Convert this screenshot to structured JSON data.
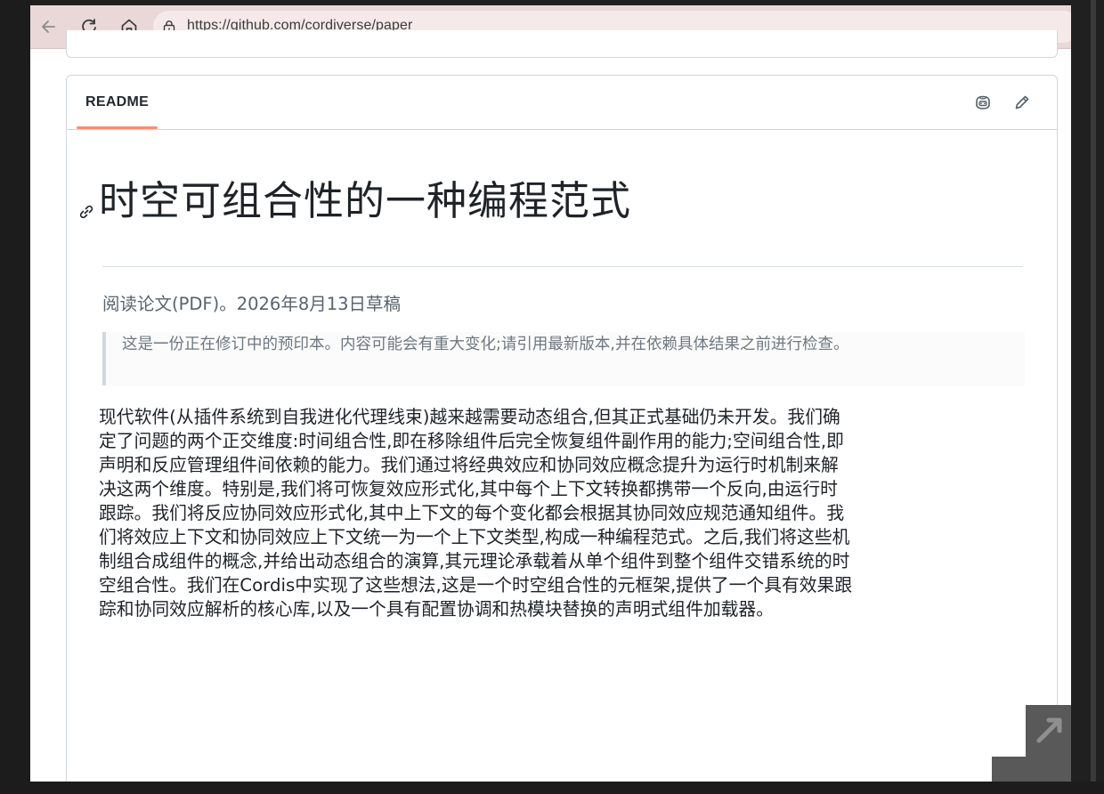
{
  "browser": {
    "url": "https://github.com/cordiverse/paper",
    "nav": {
      "back_icon": "arrow-left-icon",
      "reload_icon": "reload-icon",
      "home_icon": "home-icon",
      "lock_icon": "lock-icon"
    }
  },
  "readme": {
    "tab_label": "README",
    "header_icons": [
      "copilot-icon",
      "pencil-icon"
    ],
    "title": "时空可组合性的一种编程范式",
    "reading": "阅读论文(PDF)。2026年8月13日草稿",
    "notice": "这是一份正在修订中的预印本。内容可能会有重大变化;请引用最新版本,并在依赖具体结果之前进行检查。",
    "abstract_lines": [
      "现代软件(从插件系统到自我进化代理线束)越来越需要动态组合,但其正式基础仍未开发。我们确",
      "定了问题的两个正交维度:时间组合性,即在移除组件后完全恢复组件副作用的能力;空间组合性,即",
      "声明和反应管理组件间依赖的能力。我们通过将经典效应和协同效应概念提升为运行时机制来解",
      "决这两个维度。特别是,我们将可恢复效应形式化,其中每个上下文转换都携带一个反向,由运行时",
      "跟踪。我们将反应协同效应形式化,其中上下文的每个变化都会根据其协同效应规范通知组件。我",
      "们将效应上下文和协同效应上下文统一为一个上下文类型,构成一种编程范式。之后,我们将这些机",
      "制组合成组件的概念,并给出动态组合的演算,其元理论承载着从单个组件到整个组件交错系统的时",
      "空组合性。我们在Cordis中实现了这些想法,这是一个时空组合性的元框架,提供了一个具有效果跟",
      "踪和协同效应解析的核心库,以及一个具有配置协调和热模块替换的声明式组件加载器。"
    ]
  },
  "overlay": {
    "expand_icon": "expand-arrow-icon"
  },
  "colors": {
    "toolbar_bg": "#ead8d8",
    "tab_underline": "#fd8c73",
    "text": "#1f2328",
    "muted": "#59636e"
  }
}
